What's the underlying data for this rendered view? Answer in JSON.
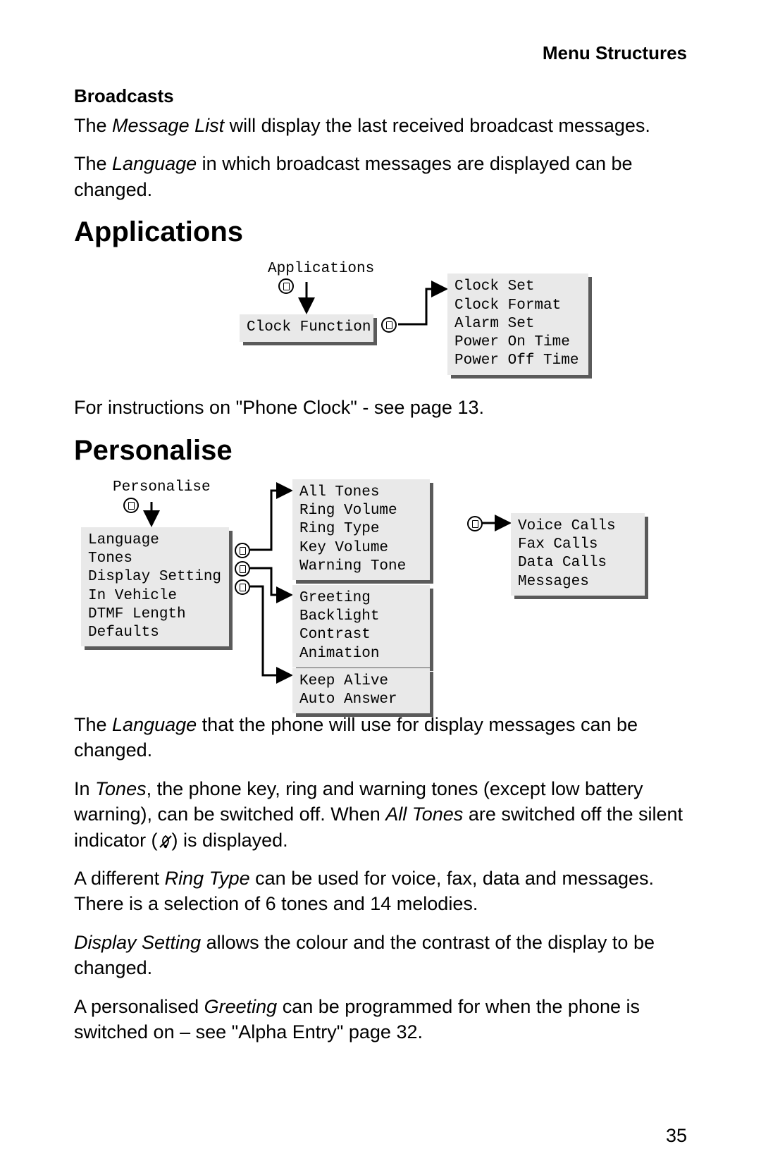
{
  "header": "Menu Structures",
  "broadcasts": {
    "title": "Broadcasts",
    "p1_a": "The ",
    "p1_i": "Message List",
    "p1_b": " will display the last received broadcast messages.",
    "p2_a": "The ",
    "p2_i": "Language",
    "p2_b": " in which broadcast messages are displayed can be changed."
  },
  "applications": {
    "title": "Applications",
    "diagram": {
      "root_label": "Applications",
      "node_label": "Clock Function",
      "submenu": "Clock Set\nClock Format\nAlarm Set\nPower On Time\nPower Off Time"
    },
    "footnote": "For instructions on \"Phone Clock\" - see page 13."
  },
  "personalise": {
    "title": "Personalise",
    "diagram": {
      "root_label": "Personalise",
      "main_menu": "Language\nTones\nDisplay Setting\nIn Vehicle\nDTMF Length\nDefaults",
      "tones_menu": "All Tones\nRing Volume\nRing Type\nKey Volume\nWarning Tone",
      "display_menu": "Greeting\nBacklight\nContrast\nAnimation",
      "vehicle_menu": "Keep Alive\nAuto Answer",
      "ringtype_menu": "Voice Calls\nFax Calls\nData Calls\nMessages"
    },
    "p1_a": "The ",
    "p1_i": "Language",
    "p1_b": " that the phone will use for display messages can be changed.",
    "p2_a": "In ",
    "p2_i1": "Tones",
    "p2_b": ", the phone key, ring and warning tones (except low battery warning), can be switched off. When ",
    "p2_i2": "All Tones",
    "p2_c": " are switched off the silent indicator (",
    "p2_d": ") is displayed.",
    "p3_a": "A different ",
    "p3_i": "Ring Type",
    "p3_b": " can be used for voice, fax, data and messages. There is a selection of 6 tones and 14 melodies.",
    "p4_i": "Display Setting",
    "p4_b": " allows the colour and the contrast of the display to be changed.",
    "p5_a": "A personalised ",
    "p5_i": "Greeting",
    "p5_b": " can be programmed for when the phone is switched on – see \"Alpha Entry\" page 32."
  },
  "page_number": "35"
}
